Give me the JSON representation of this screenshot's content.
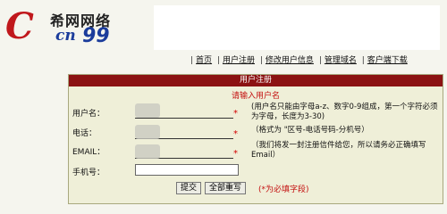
{
  "logo": {
    "title": "希网网络",
    "mark": "cn",
    "number": "99"
  },
  "nav": [
    "首页",
    "用户注册",
    "修改用户信息",
    "管理域名",
    "客户端下载"
  ],
  "panel": {
    "header": "用户注册",
    "subtitle": "请输入用户名",
    "fields": [
      {
        "label": "用户名：",
        "required": "*",
        "note": "(用户名只能由字母a-z、数字0-9组成，第一个字符必须为字母，长度为3-30)"
      },
      {
        "label": "电话：",
        "required": "*",
        "note": "（格式为 \"区号-电话号码-分机号）"
      },
      {
        "label": "EMAIL：",
        "required": "*",
        "note": "（我们将发一封注册信件给您，所以请务必正确填写Email）"
      },
      {
        "label": "手机号：",
        "required": "",
        "note": ""
      }
    ],
    "submit": "提交",
    "reset": "全部重写",
    "hint": "(*为必填字段)"
  }
}
